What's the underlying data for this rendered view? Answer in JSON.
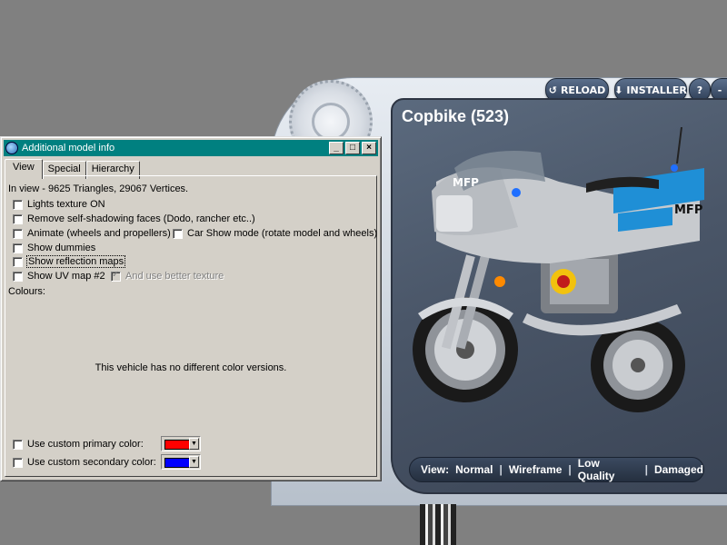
{
  "viewer": {
    "reload_label": "RELOAD",
    "installer_label": "INSTALLER",
    "help_label": "?",
    "close_label": "-",
    "model_title": "Copbike (523)",
    "view_label": "View:",
    "view_modes": [
      "Normal",
      "Wireframe",
      "Low Quality",
      "Damaged"
    ],
    "separator": "|"
  },
  "dialog": {
    "title": "Additional model info",
    "title_buttons": [
      "_",
      "□",
      "×"
    ],
    "tabs": [
      "View",
      "Special",
      "Hierarchy"
    ],
    "stats": "In view - 9625 Triangles, 29067 Vertices.",
    "options": {
      "lights": "Lights texture ON",
      "self_shadow": "Remove self-shadowing faces (Dodo, rancher etc..)",
      "animate": "Animate (wheels and propellers)",
      "car_show": "Car Show mode (rotate model and wheels)",
      "dummies": "Show dummies",
      "reflection": "Show reflection maps",
      "uv_map": "Show UV map #2",
      "better_texture": "And use better texture"
    },
    "colours_label": "Colours:",
    "no_colors_msg": "This vehicle has no different color versions.",
    "primary_label": "Use custom primary color:",
    "secondary_label": "Use custom secondary color:",
    "primary_color": "#ff0000",
    "secondary_color": "#0000ff",
    "dropdown_arrow": "▼"
  }
}
